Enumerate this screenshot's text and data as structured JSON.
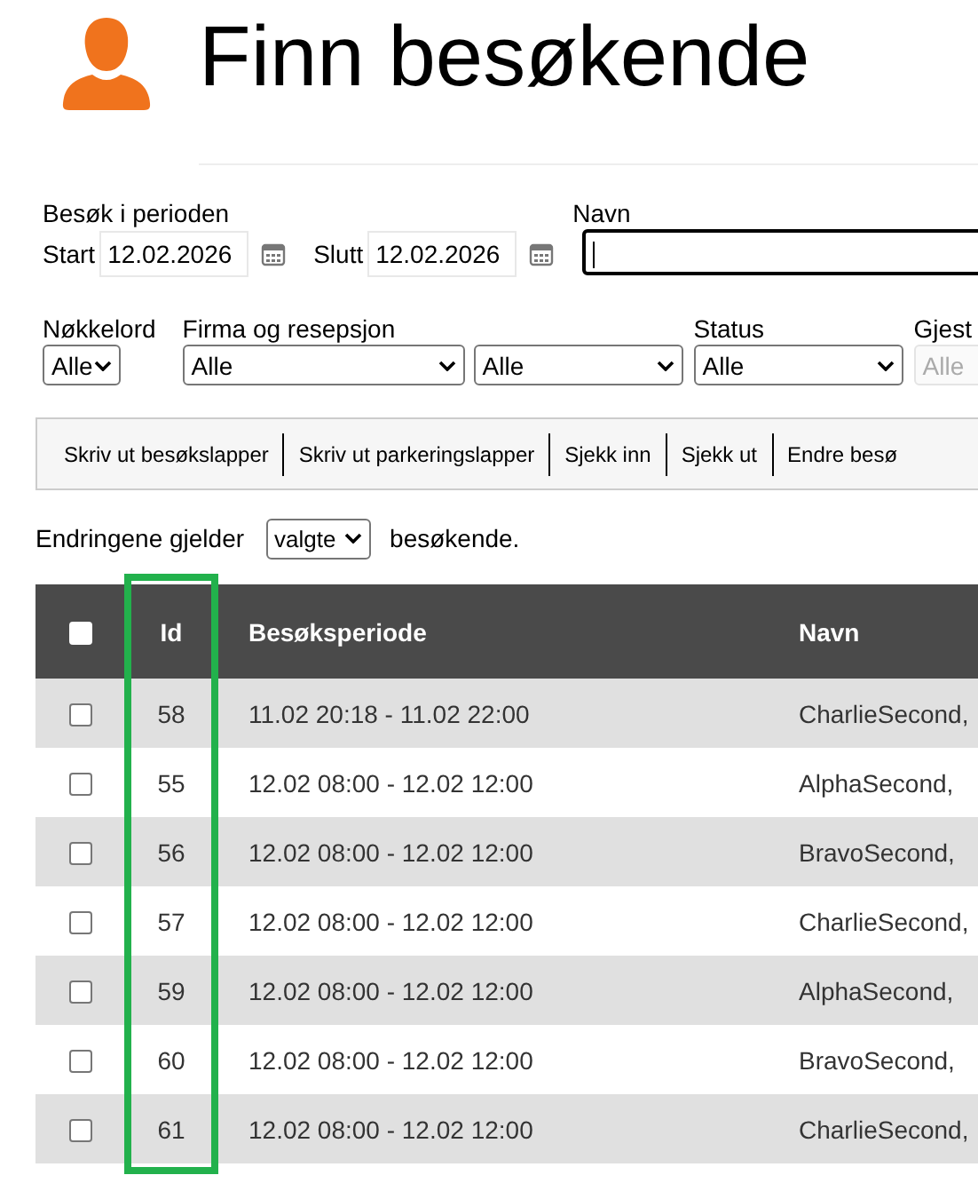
{
  "header": {
    "title": "Finn besøkende"
  },
  "period": {
    "label": "Besøk i perioden",
    "start_label": "Start",
    "start_value": "12.02.2026",
    "end_label": "Slutt",
    "end_value": "12.02.2026"
  },
  "name_field": {
    "label": "Navn",
    "focused": true
  },
  "filters": [
    {
      "label": "Nøkkelord",
      "selects": [
        {
          "value": "Alle",
          "disabled": false
        }
      ]
    },
    {
      "label": "Firma og resepsjon",
      "selects": [
        {
          "value": "Alle",
          "disabled": false
        },
        {
          "value": "Alle",
          "disabled": false
        }
      ]
    },
    {
      "label": "Status",
      "selects": [
        {
          "value": "Alle",
          "disabled": false
        }
      ]
    },
    {
      "label": "Gjest",
      "selects": [
        {
          "value": "Alle",
          "disabled": true
        }
      ]
    }
  ],
  "toolbar": [
    "Skriv ut besøkslapper",
    "Skriv ut parkeringslapper",
    "Sjekk inn",
    "Sjekk ut",
    "Endre besø"
  ],
  "scope": {
    "prefix": "Endringene gjelder",
    "value": "valgte",
    "suffix": "besøkende."
  },
  "table": {
    "all_checked": false,
    "columns": [
      {
        "label": "Id",
        "highlighted": true
      },
      {
        "label": "Besøksperiode",
        "highlighted": false
      },
      {
        "label": "Navn",
        "highlighted": false
      }
    ],
    "rows": [
      {
        "checked": false,
        "id": "58",
        "period": "11.02 20:18 - 11.02 22:00",
        "name": "CharlieSecond,"
      },
      {
        "checked": false,
        "id": "55",
        "period": "12.02 08:00 - 12.02 12:00",
        "name": "AlphaSecond,"
      },
      {
        "checked": false,
        "id": "56",
        "period": "12.02 08:00 - 12.02 12:00",
        "name": "BravoSecond,"
      },
      {
        "checked": false,
        "id": "57",
        "period": "12.02 08:00 - 12.02 12:00",
        "name": "CharlieSecond,"
      },
      {
        "checked": false,
        "id": "59",
        "period": "12.02 08:00 - 12.02 12:00",
        "name": "AlphaSecond,"
      },
      {
        "checked": false,
        "id": "60",
        "period": "12.02 08:00 - 12.02 12:00",
        "name": "BravoSecond,"
      },
      {
        "checked": false,
        "id": "61",
        "period": "12.02 08:00 - 12.02 12:00",
        "name": "CharlieSecond,"
      }
    ]
  }
}
